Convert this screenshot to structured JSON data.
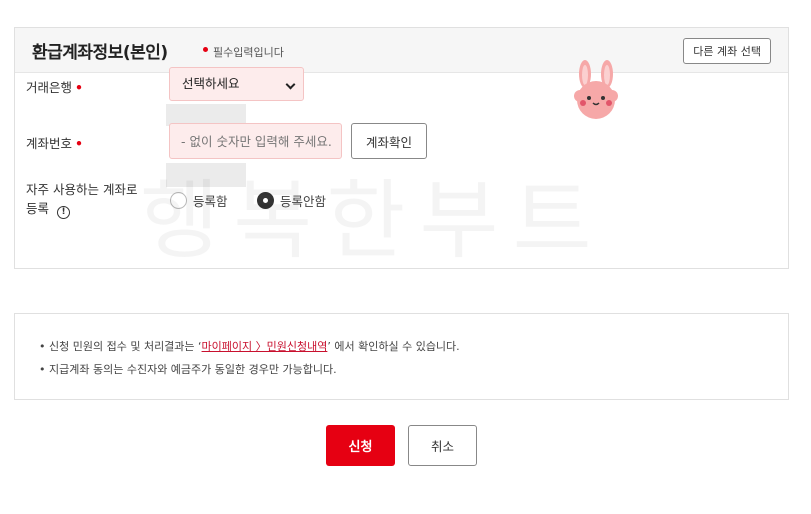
{
  "section": {
    "title": "환급계좌정보(본인)",
    "required_note": "필수입력입니다",
    "other_account_button": "다른 계좌 선택"
  },
  "form": {
    "bank_label": "거래은행",
    "bank_select_value": "선택하세요",
    "account_label": "계좌번호",
    "account_placeholder": "- 없이 숫자만 입력해 주세요.",
    "account_check_button": "계좌확인",
    "frequent_label_line1": "자주 사용하는 계좌로",
    "frequent_label_line2": "등록",
    "radio_register": "등록함",
    "radio_not_register": "등록안함",
    "radio_selected": "등록안함",
    "required_mark": "•"
  },
  "notice": {
    "line1_prefix": "신청 민원의 접수 및 처리결과는 ‘",
    "line1_link": "마이페이지 〉민원신청내역",
    "line1_suffix": "’ 에서 확인하실 수 있습니다.",
    "line2": "지급계좌 동의는 수진자와 예금주가 동일한 경우만 가능합니다.",
    "bullet": "•"
  },
  "actions": {
    "apply": "신청",
    "cancel": "취소"
  },
  "watermark": "행복한부트",
  "colors": {
    "accent": "#e60012",
    "input_bg": "#fdecec"
  },
  "icons": {
    "info": "info-circle-icon",
    "dropdown": "chevron-down-icon",
    "sticker": "bunny-sticker-icon"
  }
}
